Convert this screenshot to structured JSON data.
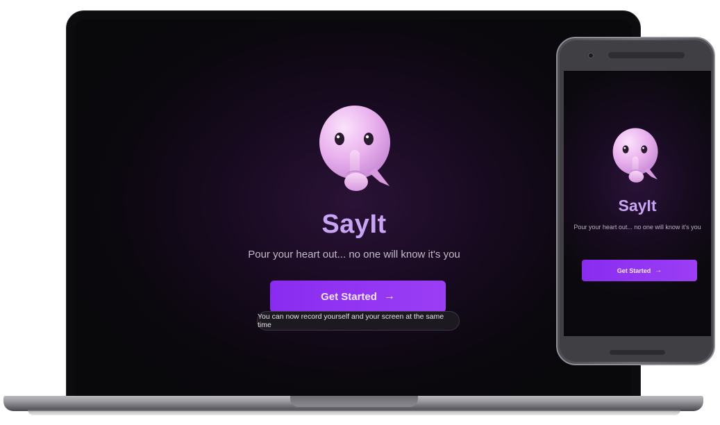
{
  "app": {
    "title": "SayIt",
    "subtitle": "Pour your heart out... no one will know it's you",
    "cta_label": "Get Started",
    "cta_icon": "arrow-right-icon",
    "brand_color": "#9b3ef5",
    "title_color": "#c9a3f4"
  },
  "toast": {
    "message": "You can now record yourself and your screen at the same time"
  },
  "mascot": {
    "icon": "shushing-face-icon"
  }
}
